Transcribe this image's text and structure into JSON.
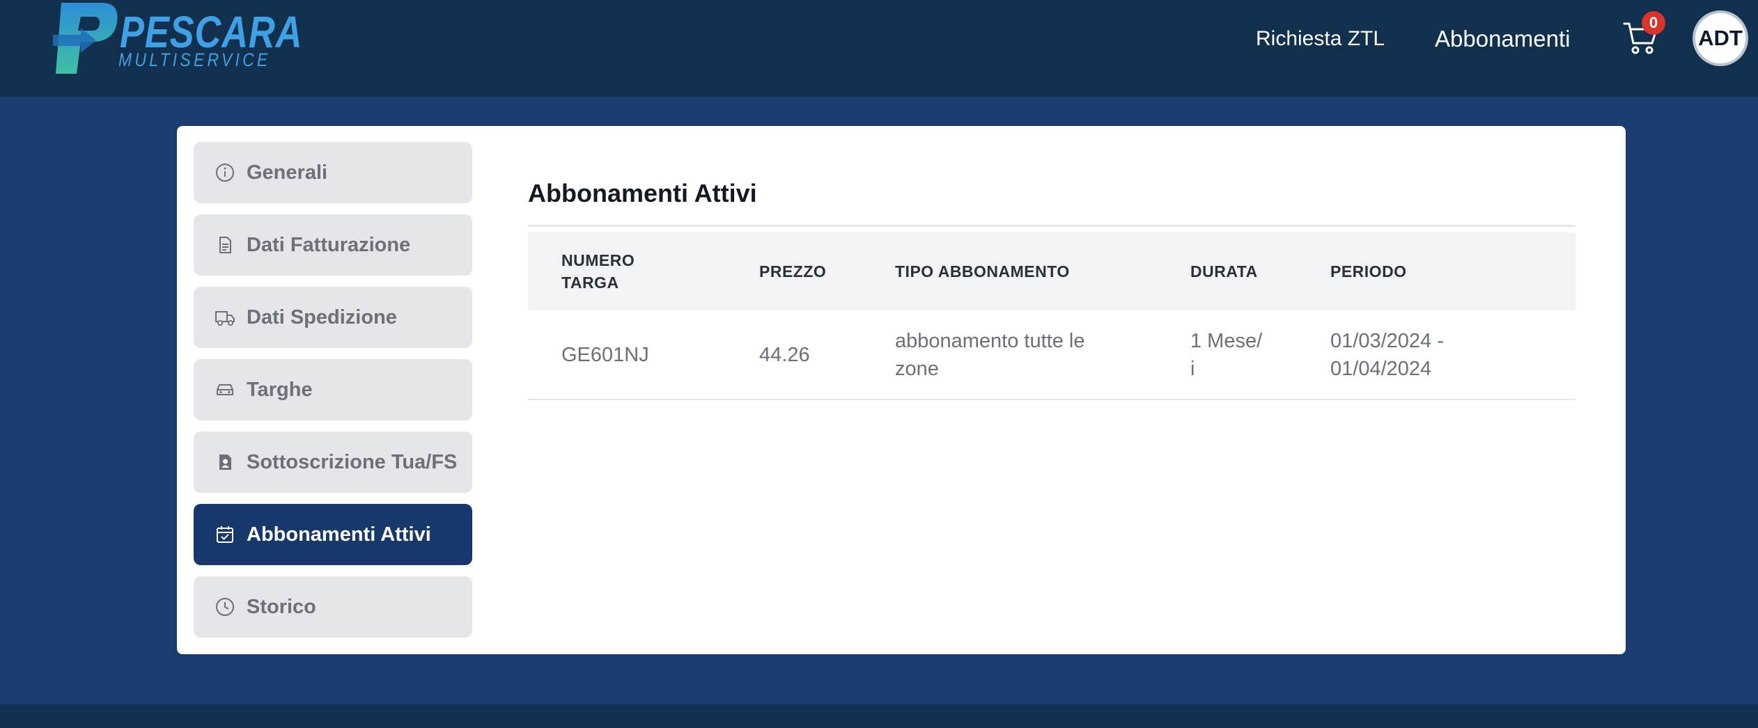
{
  "header": {
    "logo": {
      "word": "PESCARA",
      "sub": "MULTISERVICE"
    },
    "nav": {
      "ztl": "Richiesta ZTL",
      "abbonamenti": "Abbonamenti"
    },
    "cart": {
      "icon": "cart-icon",
      "count": "0",
      "badge_color": "#d9342b"
    },
    "avatar": "ADT"
  },
  "sidebar": {
    "items": [
      {
        "label": "Generali",
        "icon": "info-icon",
        "active": false
      },
      {
        "label": "Dati Fatturazione",
        "icon": "document-icon",
        "active": false
      },
      {
        "label": "Dati Spedizione",
        "icon": "truck-icon",
        "active": false
      },
      {
        "label": "Targhe",
        "icon": "car-icon",
        "active": false
      },
      {
        "label": "Sottoscrizione Tua/FS",
        "icon": "badge-icon",
        "active": false
      },
      {
        "label": "Abbonamenti Attivi",
        "icon": "calendar-check-icon",
        "active": true
      },
      {
        "label": "Storico",
        "icon": "clock-icon",
        "active": false
      }
    ],
    "active_color": "#17386a"
  },
  "main": {
    "title": "Abbonamenti Attivi",
    "table": {
      "headers": [
        "NUMERO TARGA",
        "PREZZO",
        "TIPO ABBONAMENTO",
        "DURATA",
        "PERIODO"
      ],
      "rows": [
        {
          "targa": "GE601NJ",
          "prezzo": "44.26",
          "tipo": "abbonamento tutte le zone",
          "durata": "1 Mese/ i",
          "periodo": "01/03/2024 - 01/04/2024"
        }
      ]
    }
  },
  "colors": {
    "page_bg": "#1a3c71",
    "header_bg": "#10304e",
    "logo": "#3fa0e6"
  }
}
